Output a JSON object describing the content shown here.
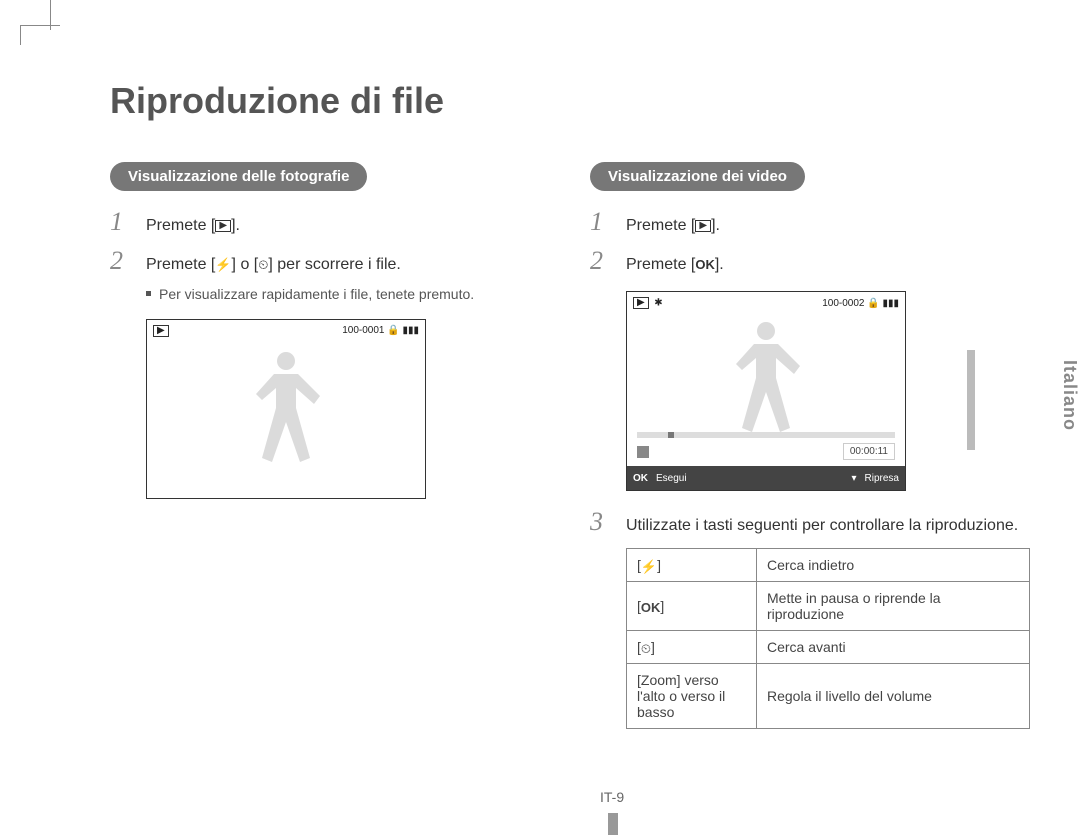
{
  "page": {
    "title": "Riproduzione di file",
    "language_tab": "Italiano",
    "page_number": "IT-9"
  },
  "left": {
    "heading": "Visualizzazione delle fotografie",
    "step1": "Premete [",
    "step1_suffix": "].",
    "step2_a": "Premete [",
    "step2_b": "] o [",
    "step2_c": "] per scorrere i file.",
    "sub": "Per visualizzare rapidamente i file, tenete premuto.",
    "lcd_counter": "100-0001"
  },
  "right": {
    "heading": "Visualizzazione dei video",
    "step1": "Premete [",
    "step1_suffix": "].",
    "step2": "Premete [",
    "step2_suffix": "].",
    "step3": "Utilizzate i tasti seguenti per controllare la riproduzione.",
    "lcd_counter": "100-0002",
    "lcd_time": "00:00:11",
    "lcd_left_label": "Esegui",
    "lcd_right_label": "Ripresa",
    "table": {
      "r1_desc": "Cerca indietro",
      "r2_desc": "Mette in pausa o riprende la riproduzione",
      "r3_desc": "Cerca avanti",
      "r4_key": "[Zoom] verso l'alto o verso il basso",
      "r4_desc": "Regola il livello del volume"
    }
  },
  "icons": {
    "play": "▶",
    "flash": "⚡",
    "timer": "⏲",
    "ok": "OK",
    "down": "▾",
    "battery": "▮▮▮",
    "film": "✱"
  }
}
